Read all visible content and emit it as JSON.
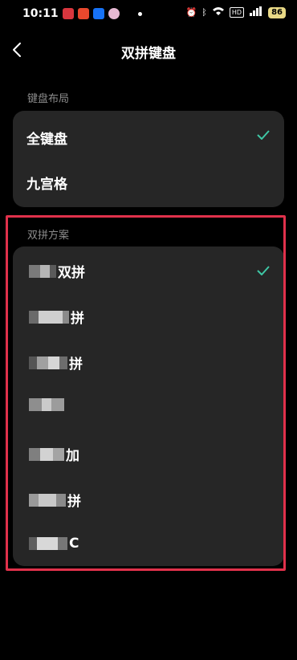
{
  "status_bar": {
    "time": "10:11",
    "battery": "86",
    "hd": "HD"
  },
  "header": {
    "title": "双拼键盘"
  },
  "keyboard_layout": {
    "section_label": "键盘布局",
    "options": [
      {
        "label": "全键盘",
        "selected": true
      },
      {
        "label": "九宫格",
        "selected": false
      }
    ]
  },
  "shuangpin_scheme": {
    "section_label": "双拼方案",
    "options": [
      {
        "suffix": "双拼",
        "selected": true
      },
      {
        "suffix": "拼",
        "selected": false
      },
      {
        "suffix": "拼",
        "selected": false
      },
      {
        "suffix": "",
        "selected": false
      },
      {
        "suffix": "加",
        "selected": false
      },
      {
        "suffix": "拼",
        "selected": false
      },
      {
        "suffix": "C",
        "selected": false
      }
    ]
  },
  "colors": {
    "check": "#3ec7a5",
    "card": "#262626",
    "highlight": "#e0314b"
  }
}
